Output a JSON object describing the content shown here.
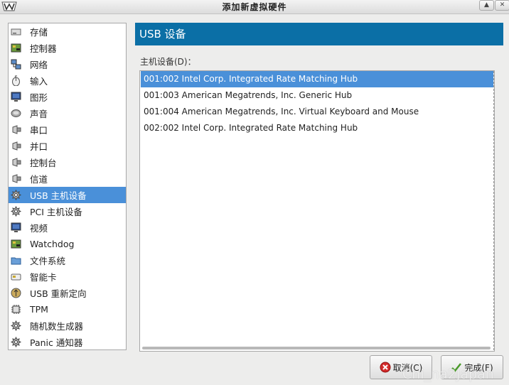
{
  "window": {
    "title": "添加新虚拟硬件"
  },
  "sidebar": {
    "items": [
      {
        "label": "存储",
        "icon": "disk-icon"
      },
      {
        "label": "控制器",
        "icon": "controller-icon"
      },
      {
        "label": "网络",
        "icon": "network-icon"
      },
      {
        "label": "输入",
        "icon": "mouse-icon"
      },
      {
        "label": "图形",
        "icon": "monitor-icon"
      },
      {
        "label": "声音",
        "icon": "speaker-icon"
      },
      {
        "label": "串口",
        "icon": "port-icon"
      },
      {
        "label": "并口",
        "icon": "port-icon"
      },
      {
        "label": "控制台",
        "icon": "port-icon"
      },
      {
        "label": "信道",
        "icon": "port-icon"
      },
      {
        "label": "USB 主机设备",
        "icon": "device-icon",
        "selected": true
      },
      {
        "label": "PCI 主机设备",
        "icon": "device-icon"
      },
      {
        "label": "视频",
        "icon": "monitor-icon"
      },
      {
        "label": "Watchdog",
        "icon": "controller-icon"
      },
      {
        "label": "文件系统",
        "icon": "folder-icon"
      },
      {
        "label": "智能卡",
        "icon": "smartcard-icon"
      },
      {
        "label": "USB 重新定向",
        "icon": "usb-redirect-icon"
      },
      {
        "label": "TPM",
        "icon": "chip-icon"
      },
      {
        "label": "随机数生成器",
        "icon": "device-icon"
      },
      {
        "label": "Panic 通知器",
        "icon": "device-icon"
      }
    ]
  },
  "main": {
    "header": "USB 设备",
    "list_label": "主机设备(D)：",
    "devices": [
      {
        "label": "001:002 Intel Corp. Integrated Rate Matching Hub",
        "selected": true
      },
      {
        "label": "001:003 American Megatrends, Inc. Generic Hub"
      },
      {
        "label": "001:004 American Megatrends, Inc. Virtual Keyboard and Mouse"
      },
      {
        "label": "002:002 Intel Corp. Integrated Rate Matching Hub"
      }
    ]
  },
  "buttons": {
    "cancel": "取消(C)",
    "finish": "完成(F)"
  },
  "watermark": "Chi_na2Japan"
}
